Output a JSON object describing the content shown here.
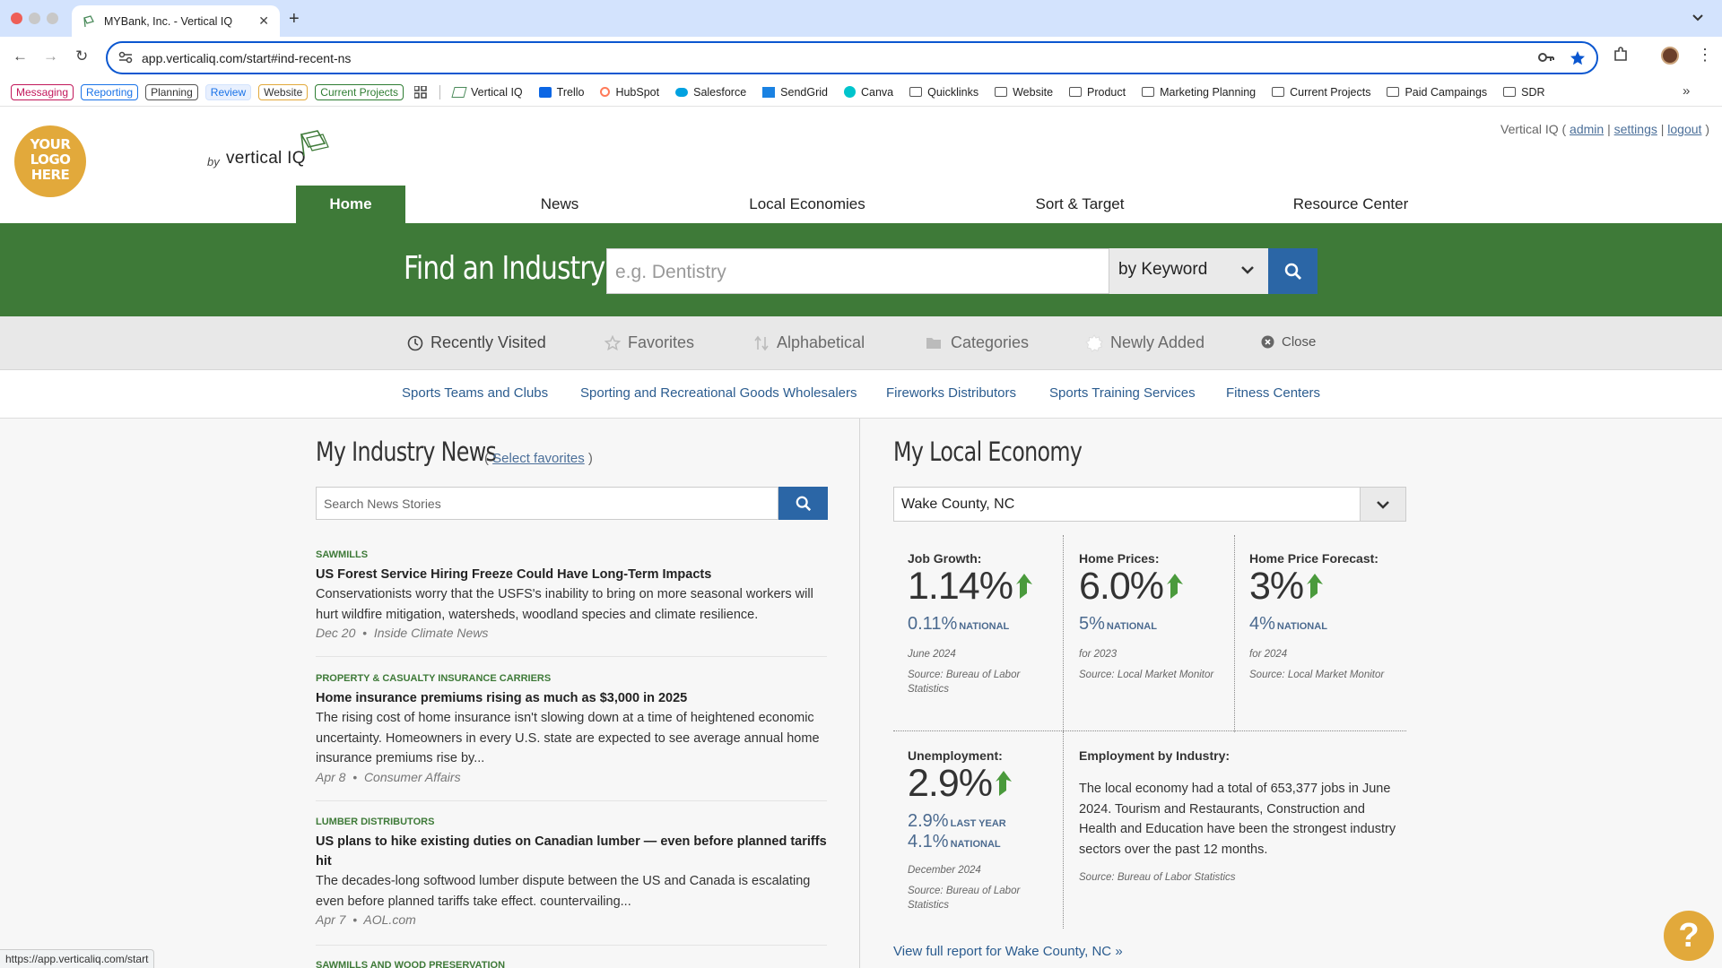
{
  "browser": {
    "tab_title": "MYBank, Inc. - Vertical IQ",
    "url": "app.verticaliq.com/start#ind-recent-ns",
    "status_url": "https://app.verticaliq.com/start",
    "bookmark_chips": [
      {
        "label": "Messaging",
        "color": "#c2185b"
      },
      {
        "label": "Reporting",
        "color": "#1a73e8"
      },
      {
        "label": "Planning",
        "color": "#555555"
      },
      {
        "label": "Review",
        "color": "#1a73e8"
      },
      {
        "label": "Website",
        "color": "#e2a93b"
      },
      {
        "label": "Current Projects",
        "color": "#2e7d32"
      }
    ],
    "bookmarks": [
      "Vertical IQ",
      "Trello",
      "HubSpot",
      "Salesforce",
      "SendGrid",
      "Canva"
    ],
    "folders": [
      "Quicklinks",
      "Website",
      "Product",
      "Marketing Planning",
      "Current Projects",
      "Paid Campaings",
      "SDR"
    ]
  },
  "header": {
    "logo_text": "YOUR LOGO HERE",
    "by": "by",
    "brand": "vertical IQ",
    "admin_prefix": "Vertical IQ (",
    "admin": "admin",
    "sep1": "|",
    "settings": "settings",
    "sep2": "|",
    "logout": "logout",
    "admin_suffix": ")"
  },
  "nav": {
    "items": [
      "Home",
      "News",
      "Local Economies",
      "Sort & Target",
      "Resource Center"
    ]
  },
  "find": {
    "title": "Find an Industry",
    "placeholder": "e.g. Dentistry",
    "mode": "by Keyword"
  },
  "subtabs": [
    "Recently Visited",
    "Favorites",
    "Alphabetical",
    "Categories",
    "Newly Added",
    "Close"
  ],
  "recents": [
    "Sports Teams and Clubs",
    "Sporting and Recreational Goods Wholesalers",
    "Fireworks Distributors",
    "Sports Training Services",
    "Fitness Centers"
  ],
  "news": {
    "title": "My Industry News",
    "select_prefix": "(",
    "select_link": "Select favorites",
    "select_suffix": ")",
    "search_placeholder": "Search News Stories",
    "items": [
      {
        "category": "SAWMILLS",
        "headline": "US Forest Service Hiring Freeze Could Have Long-Term Impacts",
        "body": "Conservationists worry that the USFS's inability to bring on more seasonal workers will hurt wildfire mitigation, watersheds, woodland species and climate resilience.",
        "date": "Dec 20",
        "source": "Inside Climate News"
      },
      {
        "category": "PROPERTY & CASUALTY INSURANCE CARRIERS",
        "headline": "Home insurance premiums rising as much as $3,000 in 2025",
        "body": "The rising cost of home insurance isn't slowing down at a time of heightened economic uncertainty. Homeowners in every U.S. state are expected to see average annual home insurance premiums rise by...",
        "date": "Apr 8",
        "source": "Consumer Affairs"
      },
      {
        "category": "LUMBER DISTRIBUTORS",
        "headline": "US plans to hike existing duties on Canadian lumber — even before planned tariffs hit",
        "body": "The decades-long softwood lumber dispute between the US and Canada is escalating even before planned tariffs take effect. countervailing...",
        "date": "Apr 7",
        "source": "AOL.com"
      },
      {
        "category": "SAWMILLS AND WOOD PRESERVATION"
      }
    ]
  },
  "economy": {
    "title": "My Local Economy",
    "location": "Wake County, NC",
    "job_growth": {
      "label": "Job Growth:",
      "value": "1.14%",
      "national": "0.11%",
      "national_label": "NATIONAL",
      "period": "June 2024",
      "source": "Source: Bureau of Labor Statistics"
    },
    "home_prices": {
      "label": "Home Prices:",
      "value": "6.0%",
      "national": "5%",
      "national_label": "NATIONAL",
      "period": "for 2023",
      "source": "Source: Local Market Monitor"
    },
    "home_forecast": {
      "label": "Home Price Forecast:",
      "value": "3%",
      "national": "4%",
      "national_label": "NATIONAL",
      "period": "for 2024",
      "source": "Source: Local Market Monitor"
    },
    "unemployment": {
      "label": "Unemployment:",
      "value": "2.9%",
      "last_year": "2.9%",
      "last_year_label": "LAST YEAR",
      "national": "4.1%",
      "national_label": "NATIONAL",
      "period": "December 2024",
      "source": "Source: Bureau of Labor Statistics"
    },
    "employment": {
      "label": "Employment by Industry:",
      "text": "The local economy had a total of 653,377 jobs in June 2024. Tourism and Restaurants, Construction and Health and Education have been the strongest industry sectors over the past 12 months.",
      "source": "Source: Bureau of Labor Statistics"
    },
    "full_report": "View full report for Wake County, NC",
    "full_report_arrow": "»"
  },
  "help": "?",
  "colors": {
    "brand_green": "#3e7a38",
    "brand_blue": "#2b66a6",
    "logo_gold": "#e2a93b",
    "up_arrow": "#4a9a3c"
  }
}
